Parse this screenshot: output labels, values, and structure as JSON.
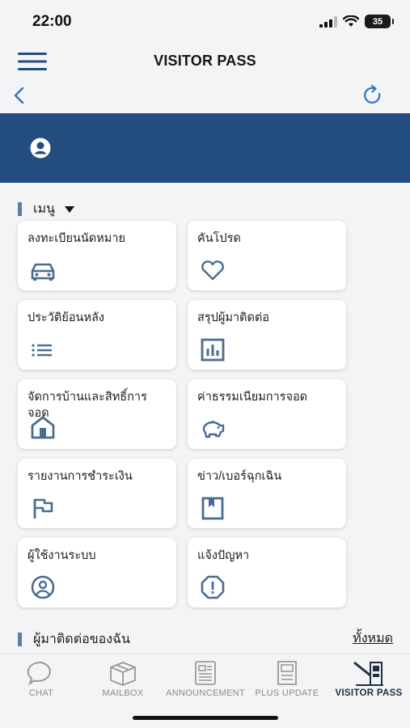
{
  "status_bar": {
    "time": "22:00",
    "battery": "35"
  },
  "header": {
    "title": "VISITOR PASS"
  },
  "menu_section": {
    "title": "เมนู"
  },
  "menu_items": [
    {
      "label": "ลงทะเบียนนัดหมาย",
      "icon": "car-icon"
    },
    {
      "label": "คันโปรด",
      "icon": "heart-icon"
    },
    {
      "label": "ประวัติย้อนหลัง",
      "icon": "list-icon"
    },
    {
      "label": "สรุปผู้มาติดต่อ",
      "icon": "bar-chart-icon"
    },
    {
      "label": "จัดการบ้านและสิทธิ์การจอด",
      "icon": "house-icon"
    },
    {
      "label": "ค่าธรรมเนียมการจอด",
      "icon": "piggy-bank-icon"
    },
    {
      "label": "รายงานการชำระเงิน",
      "icon": "flag-icon"
    },
    {
      "label": "ข่าว/เบอร์ฉุกเฉิน",
      "icon": "bookmark-icon"
    },
    {
      "label": "ผู้ใช้งานระบบ",
      "icon": "user-circle-icon"
    },
    {
      "label": "แจ้งปัญหา",
      "icon": "alert-icon"
    }
  ],
  "contacts_section": {
    "title": "ผู้มาติดต่อของฉัน",
    "see_all": "ทั้งหมด"
  },
  "tabs": [
    {
      "label": "CHAT",
      "icon": "chat-bubble-icon"
    },
    {
      "label": "MAILBOX",
      "icon": "box-icon"
    },
    {
      "label": "ANNOUNCEMENT",
      "icon": "newspaper-icon"
    },
    {
      "label": "PLUS UPDATE",
      "icon": "document-icon"
    },
    {
      "label": "VISITOR PASS",
      "icon": "gate-icon"
    }
  ],
  "colors": {
    "accent": "#234d7e",
    "icon": "#4a6d91",
    "section_bar": "#5a7ea6",
    "refresh": "#2a78c8"
  }
}
